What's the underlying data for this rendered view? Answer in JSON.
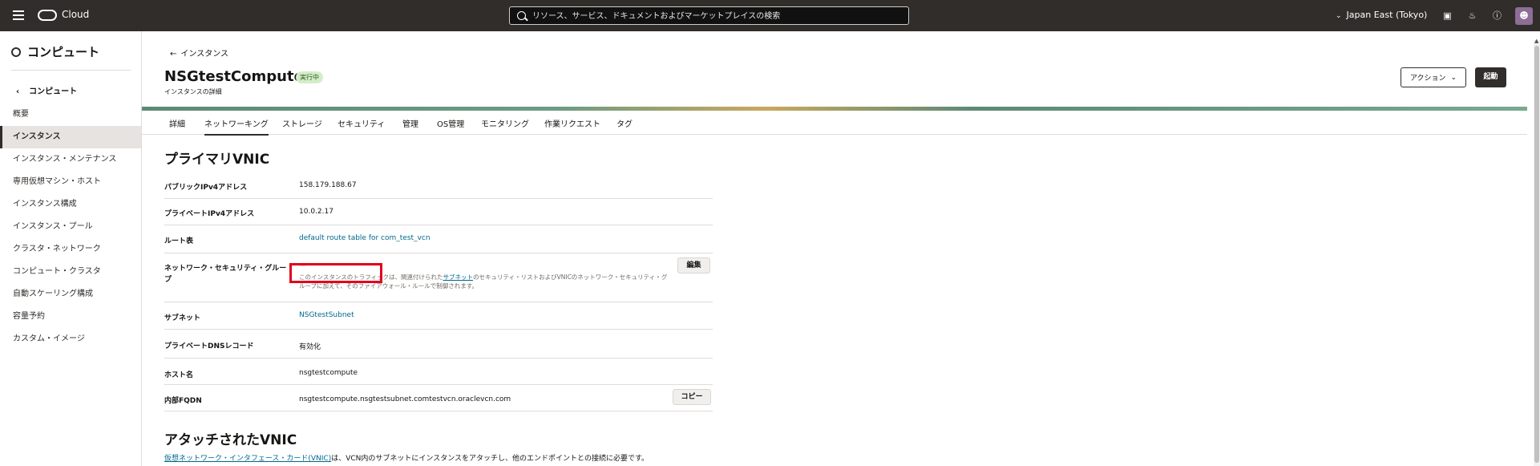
{
  "topbar": {
    "brand": "Cloud",
    "search_placeholder": "リソース、サービス、ドキュメントおよびマーケットプレイスの検索",
    "region": "Japan East (Tokyo)"
  },
  "sidebar": {
    "title": "コンピュート",
    "back_label": "コンピュート",
    "items": [
      "概要",
      "インスタンス",
      "インスタンス・メンテナンス",
      "専用仮想マシン・ホスト",
      "インスタンス構成",
      "インスタンス・プール",
      "クラスタ・ネットワーク",
      "コンピュート・クラスタ",
      "自動スケーリング構成",
      "容量予約",
      "カスタム・イメージ"
    ]
  },
  "header": {
    "back_label": "インスタンス",
    "title": "NSGtestCompute",
    "status": "実行中",
    "subtitle": "インスタンスの詳細",
    "actions_label": "アクション",
    "start_label": "起動"
  },
  "tabs": [
    "詳細",
    "ネットワーキング",
    "ストレージ",
    "セキュリティ",
    "管理",
    "OS管理",
    "モニタリング",
    "作業リクエスト",
    "タグ"
  ],
  "primary_vnic": {
    "title": "プライマリVNIC",
    "rows": {
      "public_ip_label": "パブリックIPv4アドレス",
      "public_ip": "158.179.188.67",
      "private_ip_label": "プライベートIPv4アドレス",
      "private_ip": "10.0.2.17",
      "route_label": "ルート表",
      "route": "default route table for com_test_vcn",
      "nsg_label": "ネットワーク・セキュリティ・グループ",
      "nsg_value": "—",
      "nsg_note_a": "このインスタンスのトラフィックは、関連付けられた",
      "nsg_note_link": "サブネット",
      "nsg_note_b": "のセキュリティ・リストおよびVNICのネットワーク・セキュリティ・グループに加えて、そのファイアウォール・ルールで制御されます。",
      "edit_label": "編集",
      "subnet_label": "サブネット",
      "subnet": "NSGtestSubnet",
      "dns_label": "プライベートDNSレコード",
      "dns": "有効化",
      "host_label": "ホスト名",
      "host": "nsgtestcompute",
      "fqdn_label": "内部FQDN",
      "fqdn": "nsgtestcompute.nsgtestsubnet.comtestvcn.oraclevcn.com",
      "copy_label": "コピー"
    }
  },
  "attached_vnic": {
    "title": "アタッチされたVNIC",
    "desc_link": "仮想ネットワーク・インタフェース・カード(VNIC)",
    "desc_rest": "は、VCN内のサブネットにインスタンスをアタッチし、他のエンドポイントとの接続に必要です。"
  }
}
